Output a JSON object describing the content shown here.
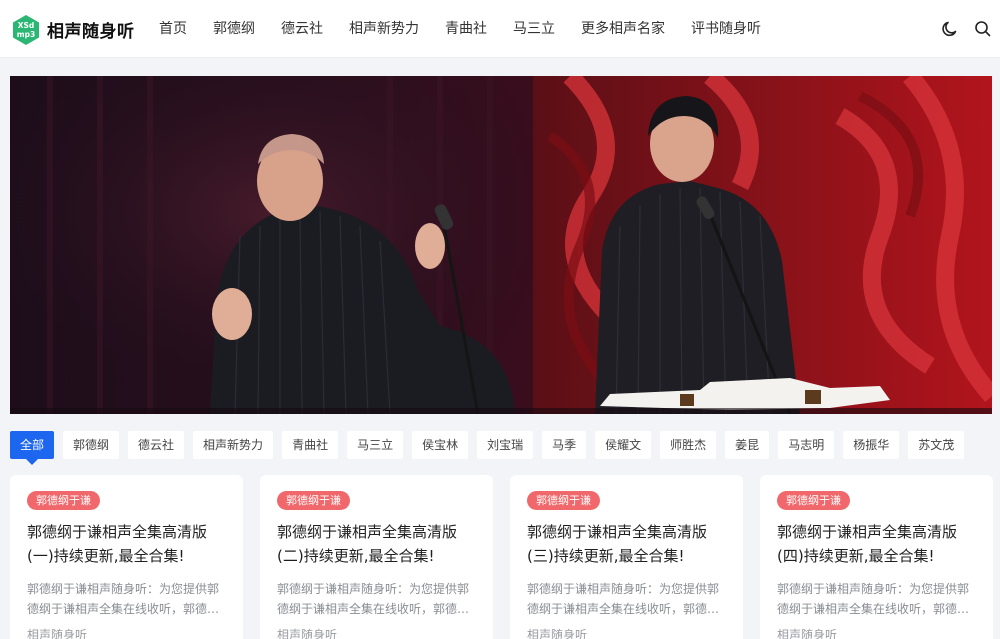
{
  "site": {
    "logo_badge_top": "XSd",
    "logo_badge_bottom": "mp3",
    "name": "相声随身听",
    "brand_color": "#2bb673"
  },
  "nav": {
    "items": [
      "首页",
      "郭德纲",
      "德云社",
      "相声新势力",
      "青曲社",
      "马三立",
      "更多相声名家",
      "评书随身听"
    ]
  },
  "header_icons": [
    "moon-icon",
    "search-icon"
  ],
  "filters": {
    "active_color": "#1d66f0",
    "items": [
      "全部",
      "郭德纲",
      "德云社",
      "相声新势力",
      "青曲社",
      "马三立",
      "侯宝林",
      "刘宝瑞",
      "马季",
      "侯耀文",
      "师胜杰",
      "姜昆",
      "马志明",
      "杨振华",
      "苏文茂"
    ]
  },
  "cards": [
    {
      "tag": "郭德纲于谦",
      "title": "郭德纲于谦相声全集高清版(一)持续更新,最全合集!",
      "desc": "郭德纲于谦相声随身听：为您提供郭德纲于谦相声全集在线收听，郭德纲于谦相声高清版持续更新",
      "source": "相声随身听"
    },
    {
      "tag": "郭德纲于谦",
      "title": "郭德纲于谦相声全集高清版(二)持续更新,最全合集!",
      "desc": "郭德纲于谦相声随身听：为您提供郭德纲于谦相声全集在线收听，郭德纲于谦相声高清版持续更新",
      "source": "相声随身听"
    },
    {
      "tag": "郭德纲于谦",
      "title": "郭德纲于谦相声全集高清版(三)持续更新,最全合集!",
      "desc": "郭德纲于谦相声随身听：为您提供郭德纲于谦相声全集在线收听，郭德纲于谦相声高清版持续更新",
      "source": "相声随身听"
    },
    {
      "tag": "郭德纲于谦",
      "title": "郭德纲于谦相声全集高清版(四)持续更新,最全合集!",
      "desc": "郭德纲于谦相声随身听：为您提供郭德纲于谦相声全集在线收听，郭德纲于谦相声高清版持续更新",
      "source": "相声随身听"
    }
  ],
  "tag_color": "#f0686b"
}
